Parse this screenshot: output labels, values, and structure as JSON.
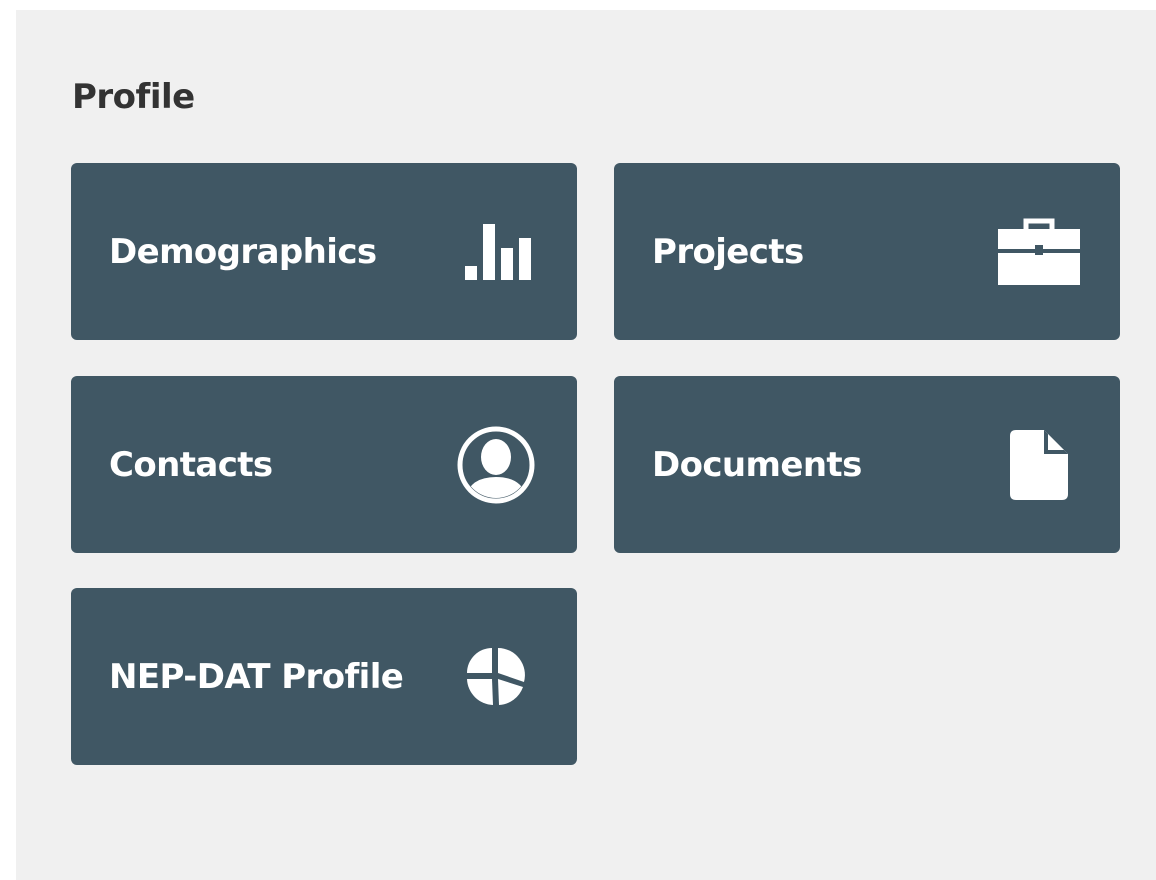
{
  "section": {
    "title": "Profile"
  },
  "tiles": {
    "demographics": {
      "label": "Demographics",
      "icon": "bar-chart-icon"
    },
    "projects": {
      "label": "Projects",
      "icon": "briefcase-icon"
    },
    "contacts": {
      "label": "Contacts",
      "icon": "user-circle-icon"
    },
    "documents": {
      "label": "Documents",
      "icon": "document-icon"
    },
    "nepdat": {
      "label": "NEP-DAT Profile",
      "icon": "pie-chart-icon"
    }
  },
  "colors": {
    "panel_background": "#f0f0f0",
    "tile_background": "#405764",
    "tile_text": "#ffffff",
    "title_text": "#333333"
  }
}
